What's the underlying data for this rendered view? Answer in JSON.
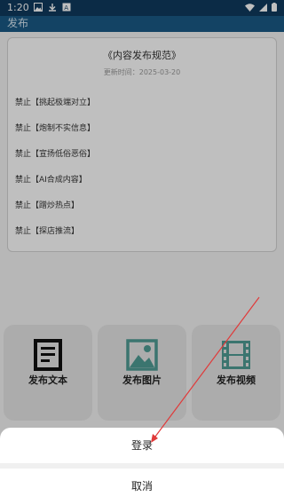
{
  "status_bar": {
    "time": "1:20"
  },
  "app_bar": {
    "title": "发布"
  },
  "rules": {
    "title": "《内容发布规范》",
    "date": "更新时间：2025-03-20",
    "items": [
      "禁止【挑起极端对立】",
      "禁止【炮制不实信息】",
      "禁止【宣扬低俗恶俗】",
      "禁止【AI合成内容】",
      "禁止【蹭炒热点】",
      "禁止【探店推流】"
    ]
  },
  "actions": {
    "text_label": "发布文本",
    "image_label": "发布图片",
    "video_label": "发布视频"
  },
  "sheet": {
    "login_label": "登录",
    "cancel_label": "取消"
  },
  "colors": {
    "status_bar": "#0f3a5e",
    "app_bar": "#1a5a86",
    "icon_teal": "#4f9c95",
    "annotation_arrow": "#e03a3a"
  }
}
